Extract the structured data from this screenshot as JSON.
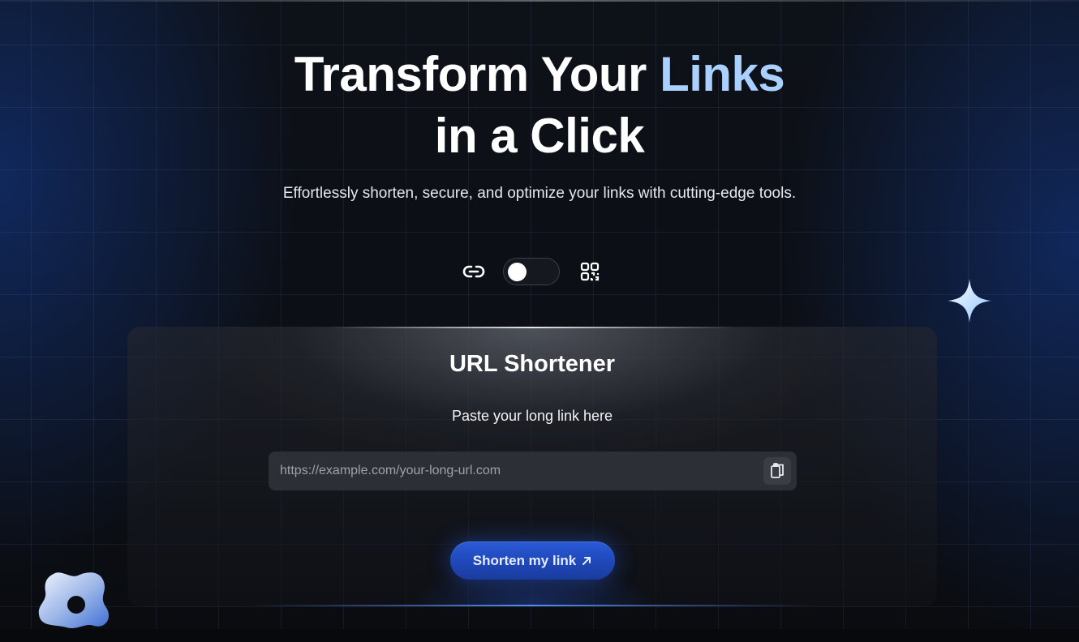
{
  "hero": {
    "title_part1": "Transform Your ",
    "title_accent": "Links",
    "title_line2": "in a Click",
    "subtitle": "Effortlessly shorten, secure, and optimize your links with cutting-edge tools."
  },
  "mode_toggle": {
    "left_icon": "link-icon",
    "right_icon": "qr-code-icon",
    "state": "link"
  },
  "card": {
    "title": "URL Shortener",
    "label": "Paste your long link here",
    "input_placeholder": "https://example.com/your-long-url.com",
    "input_value": "",
    "paste_icon": "clipboard-icon",
    "submit_label": "Shorten my link",
    "submit_icon": "arrow-up-right-icon"
  },
  "decorations": {
    "sparkle_icon": "sparkle-star-icon",
    "logo_icon": "blob-logo"
  },
  "colors": {
    "accent_text": "#a9d0ff",
    "button_blue": "#2a5bd8",
    "background": "#0b0d12"
  }
}
